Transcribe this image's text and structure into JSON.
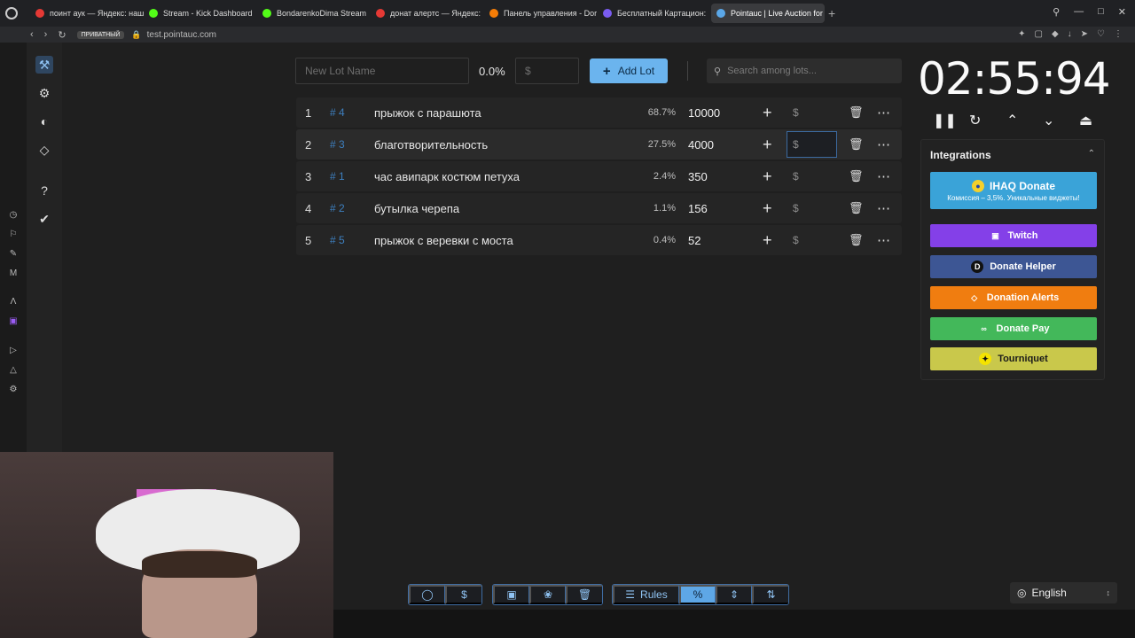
{
  "browser": {
    "tabs": [
      {
        "title": "поинт аук — Яндекс: наш",
        "color": "#e53935"
      },
      {
        "title": "Stream - Kick Dashboard",
        "color": "#53fc18"
      },
      {
        "title": "BondarenkoDima Stream",
        "color": "#53fc18"
      },
      {
        "title": "донат алертс — Яндекс:",
        "color": "#e53935"
      },
      {
        "title": "Панель управления - Dor",
        "color": "#f57d07"
      },
      {
        "title": "Бесплатный Картацион:",
        "color": "#7a5cf0"
      },
      {
        "title": "Pointauc | Live Auction for",
        "color": "#5aa7e8",
        "active": true
      }
    ],
    "private_label": "ПРИВАТНЫЙ",
    "url": "test.pointauc.com"
  },
  "controls": {
    "lot_name_placeholder": "New Lot Name",
    "percent": "0.0%",
    "amount_placeholder": "$",
    "add_lot_label": "Add Lot",
    "search_placeholder": "Search among lots..."
  },
  "lots": [
    {
      "num": "1",
      "id": "# 4",
      "name": "прыжок с парашюта",
      "percent": "68.7%",
      "amount": "10000"
    },
    {
      "num": "2",
      "id": "# 3",
      "name": "благотворительность",
      "percent": "27.5%",
      "amount": "4000"
    },
    {
      "num": "3",
      "id": "# 1",
      "name": "час авипарк костюм петуха",
      "percent": "2.4%",
      "amount": "350"
    },
    {
      "num": "4",
      "id": "# 2",
      "name": "бутылка черепа",
      "percent": "1.1%",
      "amount": "156"
    },
    {
      "num": "5",
      "id": "# 5",
      "name": "прыжок с веревки с моста",
      "percent": "0.4%",
      "amount": "52"
    }
  ],
  "lot_dollar": "$",
  "timer": "02:55:94",
  "integrations": {
    "title": "Integrations",
    "items": [
      {
        "label": "IHAQ Donate",
        "sub": "Комиссия – 3,5%. Уникальные виджеты!",
        "bg": "#3aa3d8",
        "fg": "#ffffff"
      },
      {
        "label": "Twitch",
        "bg": "#8440e8",
        "fg": "#ffffff"
      },
      {
        "label": "Donate Helper",
        "bg": "#3d5694",
        "fg": "#ffffff"
      },
      {
        "label": "Donation Alerts",
        "bg": "#f07d10",
        "fg": "#ffffff"
      },
      {
        "label": "Donate Pay",
        "bg": "#43b85a",
        "fg": "#ffffff"
      },
      {
        "label": "Tourniquet",
        "bg": "#c9c84b",
        "fg": "#1a1a1a"
      }
    ]
  },
  "toolbar": {
    "rules_label": "Rules"
  },
  "language": "English"
}
